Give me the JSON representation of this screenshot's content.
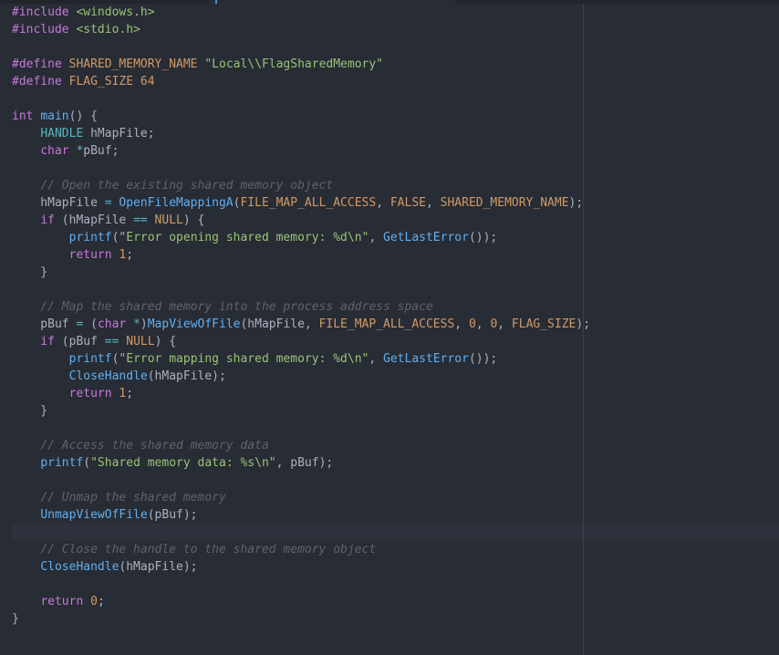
{
  "editor": {
    "language": "c",
    "cursor_line": 31
  },
  "lines": [
    [
      {
        "t": "#include",
        "c": "kw"
      },
      {
        "t": " ",
        "c": "pu"
      },
      {
        "t": "<windows.h>",
        "c": "str"
      }
    ],
    [
      {
        "t": "#include",
        "c": "kw"
      },
      {
        "t": " ",
        "c": "pu"
      },
      {
        "t": "<stdio.h>",
        "c": "str"
      }
    ],
    [],
    [
      {
        "t": "#define",
        "c": "kw"
      },
      {
        "t": " ",
        "c": "pu"
      },
      {
        "t": "SHARED_MEMORY_NAME",
        "c": "con"
      },
      {
        "t": " ",
        "c": "pu"
      },
      {
        "t": "\"Local\\\\FlagSharedMemory\"",
        "c": "str"
      }
    ],
    [
      {
        "t": "#define",
        "c": "kw"
      },
      {
        "t": " ",
        "c": "pu"
      },
      {
        "t": "FLAG_SIZE",
        "c": "con"
      },
      {
        "t": " ",
        "c": "pu"
      },
      {
        "t": "64",
        "c": "num"
      }
    ],
    [],
    [
      {
        "t": "int",
        "c": "kw"
      },
      {
        "t": " ",
        "c": "pu"
      },
      {
        "t": "main",
        "c": "fn"
      },
      {
        "t": "() {",
        "c": "pu"
      }
    ],
    [
      {
        "t": "    ",
        "c": "pu"
      },
      {
        "t": "HANDLE",
        "c": "ty"
      },
      {
        "t": " hMapFile;",
        "c": "id"
      }
    ],
    [
      {
        "t": "    ",
        "c": "pu"
      },
      {
        "t": "char",
        "c": "kw"
      },
      {
        "t": " ",
        "c": "pu"
      },
      {
        "t": "*",
        "c": "op"
      },
      {
        "t": "pBuf;",
        "c": "id"
      }
    ],
    [],
    [
      {
        "t": "    ",
        "c": "pu"
      },
      {
        "t": "// Open the existing shared memory object",
        "c": "cm"
      }
    ],
    [
      {
        "t": "    hMapFile ",
        "c": "id"
      },
      {
        "t": "=",
        "c": "op"
      },
      {
        "t": " ",
        "c": "pu"
      },
      {
        "t": "OpenFileMappingA",
        "c": "fn"
      },
      {
        "t": "(",
        "c": "pu"
      },
      {
        "t": "FILE_MAP_ALL_ACCESS",
        "c": "con"
      },
      {
        "t": ", ",
        "c": "pu"
      },
      {
        "t": "FALSE",
        "c": "con"
      },
      {
        "t": ", ",
        "c": "pu"
      },
      {
        "t": "SHARED_MEMORY_NAME",
        "c": "con"
      },
      {
        "t": ");",
        "c": "pu"
      }
    ],
    [
      {
        "t": "    ",
        "c": "pu"
      },
      {
        "t": "if",
        "c": "kw"
      },
      {
        "t": " (hMapFile ",
        "c": "id"
      },
      {
        "t": "==",
        "c": "op"
      },
      {
        "t": " ",
        "c": "pu"
      },
      {
        "t": "NULL",
        "c": "con"
      },
      {
        "t": ") {",
        "c": "pu"
      }
    ],
    [
      {
        "t": "        ",
        "c": "pu"
      },
      {
        "t": "printf",
        "c": "fn"
      },
      {
        "t": "(",
        "c": "pu"
      },
      {
        "t": "\"Error opening shared memory: %d\\n\"",
        "c": "str"
      },
      {
        "t": ", ",
        "c": "pu"
      },
      {
        "t": "GetLastError",
        "c": "fn"
      },
      {
        "t": "());",
        "c": "pu"
      }
    ],
    [
      {
        "t": "        ",
        "c": "pu"
      },
      {
        "t": "return",
        "c": "kw"
      },
      {
        "t": " ",
        "c": "pu"
      },
      {
        "t": "1",
        "c": "num"
      },
      {
        "t": ";",
        "c": "pu"
      }
    ],
    [
      {
        "t": "    }",
        "c": "pu"
      }
    ],
    [],
    [
      {
        "t": "    ",
        "c": "pu"
      },
      {
        "t": "// Map the shared memory into the process address space",
        "c": "cm"
      }
    ],
    [
      {
        "t": "    pBuf ",
        "c": "id"
      },
      {
        "t": "=",
        "c": "op"
      },
      {
        "t": " (",
        "c": "pu"
      },
      {
        "t": "char",
        "c": "kw"
      },
      {
        "t": " ",
        "c": "pu"
      },
      {
        "t": "*",
        "c": "op"
      },
      {
        "t": ")",
        "c": "pu"
      },
      {
        "t": "MapViewOfFile",
        "c": "fn"
      },
      {
        "t": "(hMapFile, ",
        "c": "id"
      },
      {
        "t": "FILE_MAP_ALL_ACCESS",
        "c": "con"
      },
      {
        "t": ", ",
        "c": "pu"
      },
      {
        "t": "0",
        "c": "num"
      },
      {
        "t": ", ",
        "c": "pu"
      },
      {
        "t": "0",
        "c": "num"
      },
      {
        "t": ", ",
        "c": "pu"
      },
      {
        "t": "FLAG_SIZE",
        "c": "con"
      },
      {
        "t": ");",
        "c": "pu"
      }
    ],
    [
      {
        "t": "    ",
        "c": "pu"
      },
      {
        "t": "if",
        "c": "kw"
      },
      {
        "t": " (pBuf ",
        "c": "id"
      },
      {
        "t": "==",
        "c": "op"
      },
      {
        "t": " ",
        "c": "pu"
      },
      {
        "t": "NULL",
        "c": "con"
      },
      {
        "t": ") {",
        "c": "pu"
      }
    ],
    [
      {
        "t": "        ",
        "c": "pu"
      },
      {
        "t": "printf",
        "c": "fn"
      },
      {
        "t": "(",
        "c": "pu"
      },
      {
        "t": "\"Error mapping shared memory: %d\\n\"",
        "c": "str"
      },
      {
        "t": ", ",
        "c": "pu"
      },
      {
        "t": "GetLastError",
        "c": "fn"
      },
      {
        "t": "());",
        "c": "pu"
      }
    ],
    [
      {
        "t": "        ",
        "c": "pu"
      },
      {
        "t": "CloseHandle",
        "c": "fn"
      },
      {
        "t": "(hMapFile);",
        "c": "id"
      }
    ],
    [
      {
        "t": "        ",
        "c": "pu"
      },
      {
        "t": "return",
        "c": "kw"
      },
      {
        "t": " ",
        "c": "pu"
      },
      {
        "t": "1",
        "c": "num"
      },
      {
        "t": ";",
        "c": "pu"
      }
    ],
    [
      {
        "t": "    }",
        "c": "pu"
      }
    ],
    [],
    [
      {
        "t": "    ",
        "c": "pu"
      },
      {
        "t": "// Access the shared memory data",
        "c": "cm"
      }
    ],
    [
      {
        "t": "    ",
        "c": "pu"
      },
      {
        "t": "printf",
        "c": "fn"
      },
      {
        "t": "(",
        "c": "pu"
      },
      {
        "t": "\"Shared memory data: %s\\n\"",
        "c": "str"
      },
      {
        "t": ", pBuf);",
        "c": "id"
      }
    ],
    [],
    [
      {
        "t": "    ",
        "c": "pu"
      },
      {
        "t": "// Unmap the shared memory",
        "c": "cm"
      }
    ],
    [
      {
        "t": "    ",
        "c": "pu"
      },
      {
        "t": "UnmapViewOfFile",
        "c": "fn"
      },
      {
        "t": "(pBuf);",
        "c": "id"
      }
    ],
    [],
    [
      {
        "t": "    ",
        "c": "pu"
      },
      {
        "t": "// Close the handle to the shared memory object",
        "c": "cm"
      }
    ],
    [
      {
        "t": "    ",
        "c": "pu"
      },
      {
        "t": "CloseHandle",
        "c": "fn"
      },
      {
        "t": "(hMapFile);",
        "c": "id"
      }
    ],
    [],
    [
      {
        "t": "    ",
        "c": "pu"
      },
      {
        "t": "return",
        "c": "kw"
      },
      {
        "t": " ",
        "c": "pu"
      },
      {
        "t": "0",
        "c": "num"
      },
      {
        "t": ";",
        "c": "pu"
      }
    ],
    [
      {
        "t": "}",
        "c": "pu"
      }
    ]
  ]
}
